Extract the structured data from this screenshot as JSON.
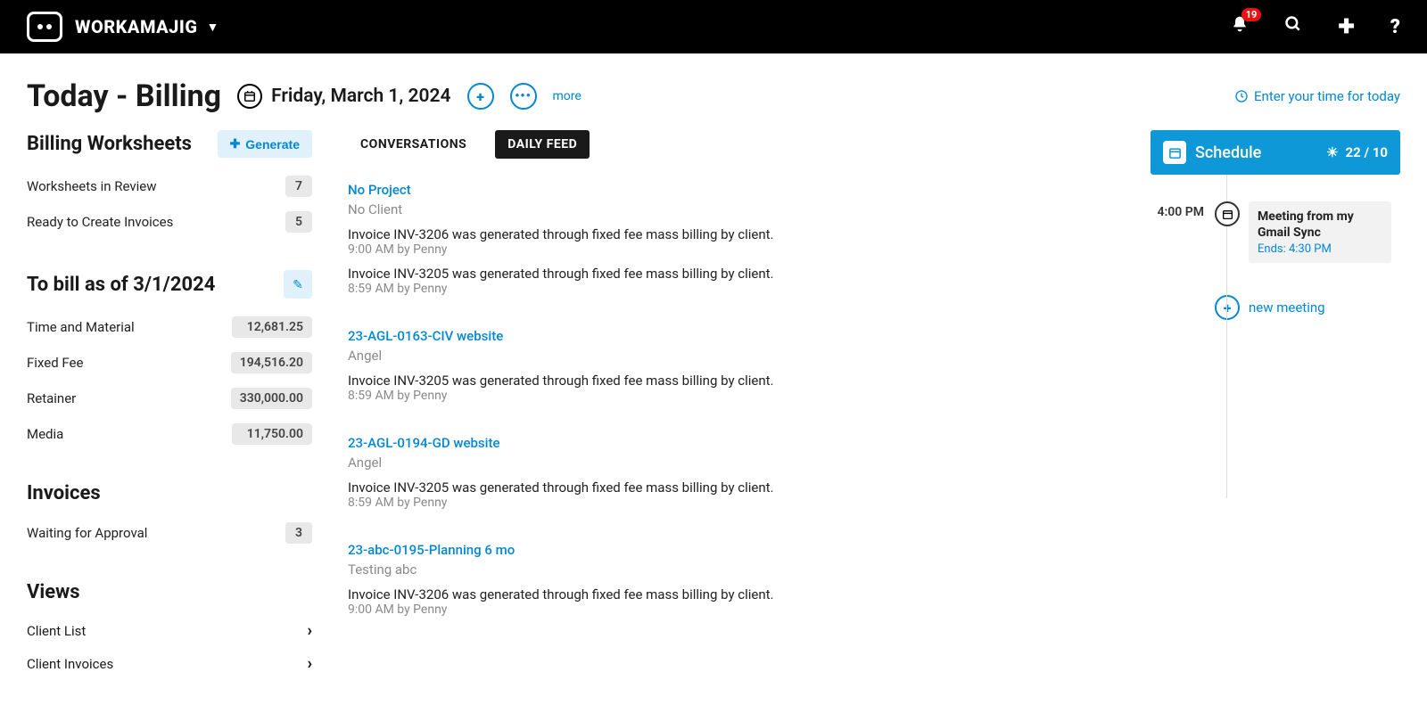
{
  "header": {
    "app_name": "WORKAMAJIG",
    "notif_count": "19"
  },
  "page": {
    "title": "Today - Billing",
    "date": "Friday, March 1, 2024",
    "more": "more",
    "time_link": "Enter your time for today"
  },
  "sidebar": {
    "worksheets": {
      "title": "Billing Worksheets",
      "generate": "Generate",
      "items": [
        {
          "label": "Worksheets in Review",
          "count": "7"
        },
        {
          "label": "Ready to Create Invoices",
          "count": "5"
        }
      ]
    },
    "tobill": {
      "title": "To bill as of 3/1/2024",
      "items": [
        {
          "label": "Time and Material",
          "amount": "12,681.25"
        },
        {
          "label": "Fixed Fee",
          "amount": "194,516.20"
        },
        {
          "label": "Retainer",
          "amount": "330,000.00"
        },
        {
          "label": "Media",
          "amount": "11,750.00"
        }
      ]
    },
    "invoices": {
      "title": "Invoices",
      "items": [
        {
          "label": "Waiting for Approval",
          "count": "3"
        }
      ]
    },
    "views": {
      "title": "Views",
      "items": [
        {
          "label": "Client List"
        },
        {
          "label": "Client Invoices"
        }
      ]
    }
  },
  "tabs": {
    "conversations": "CONVERSATIONS",
    "daily_feed": "DAILY FEED"
  },
  "feed": [
    {
      "project": "No Project",
      "client": "No Client",
      "items": [
        {
          "text": "Invoice INV-3206 was generated through fixed fee mass billing by client.",
          "meta": "9:00 AM by Penny"
        },
        {
          "text": "Invoice INV-3205 was generated through fixed fee mass billing by client.",
          "meta": "8:59 AM by Penny"
        }
      ]
    },
    {
      "project": "23-AGL-0163-CIV website",
      "client": "Angel",
      "items": [
        {
          "text": "Invoice INV-3205 was generated through fixed fee mass billing by client.",
          "meta": "8:59 AM by Penny"
        }
      ]
    },
    {
      "project": "23-AGL-0194-GD website",
      "client": "Angel",
      "items": [
        {
          "text": "Invoice INV-3205 was generated through fixed fee mass billing by client.",
          "meta": "8:59 AM by Penny"
        }
      ]
    },
    {
      "project": "23-abc-0195-Planning 6 mo",
      "client": "Testing abc",
      "items": [
        {
          "text": "Invoice INV-3206 was generated through fixed fee mass billing by client.",
          "meta": "9:00 AM by Penny"
        }
      ]
    }
  ],
  "schedule": {
    "title": "Schedule",
    "counter": "22 / 10",
    "event": {
      "time": "4:00 PM",
      "title": "Meeting from my Gmail Sync",
      "ends": "Ends: 4:30 PM"
    },
    "new_meeting": "new meeting"
  }
}
